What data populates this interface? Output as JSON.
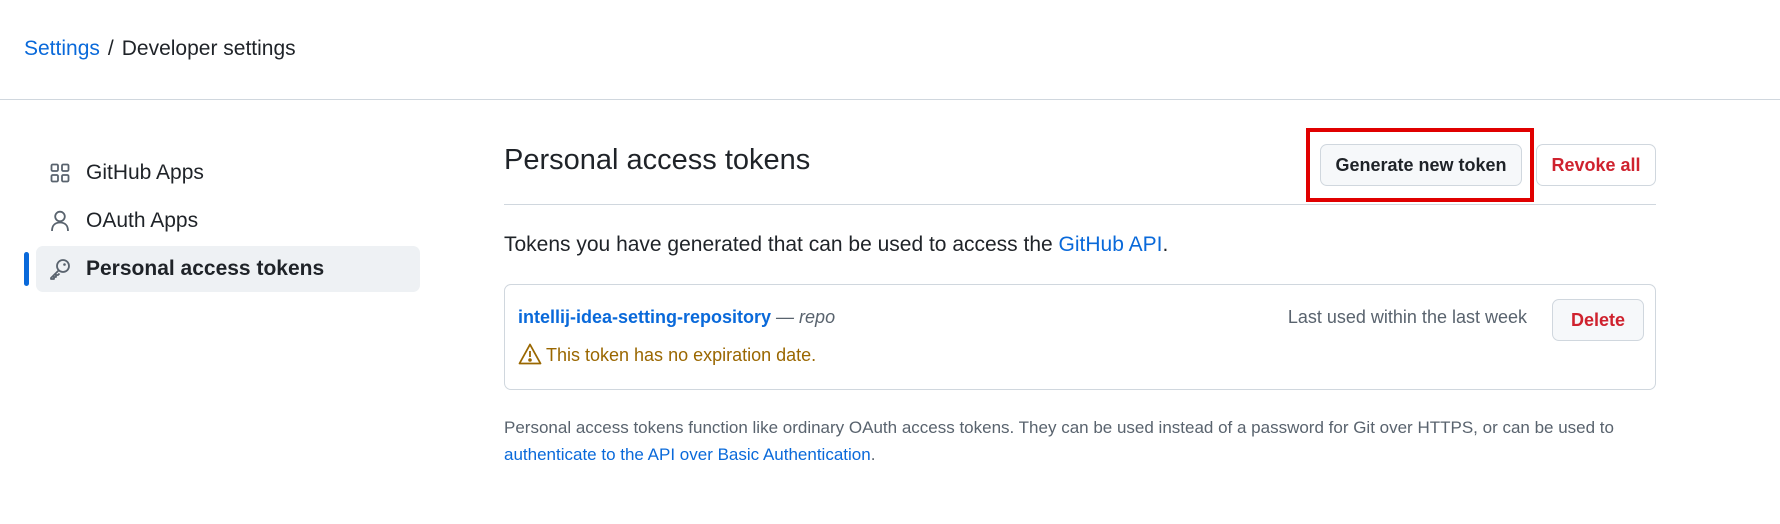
{
  "breadcrumb": {
    "parent": "Settings",
    "separator": "/",
    "current": "Developer settings"
  },
  "sidebar": {
    "items": [
      {
        "label": "GitHub Apps",
        "icon": "apps-grid-icon"
      },
      {
        "label": "OAuth Apps",
        "icon": "person-icon"
      },
      {
        "label": "Personal access tokens",
        "icon": "key-icon",
        "active": true
      }
    ]
  },
  "main": {
    "title": "Personal access tokens",
    "generate_label": "Generate new token",
    "revoke_label": "Revoke all",
    "intro_text": "Tokens you have generated that can be used to access the ",
    "intro_link": "GitHub API",
    "intro_end": ".",
    "tokens": [
      {
        "name": "intellij-idea-setting-repository",
        "scope_sep": " — ",
        "scope": "repo",
        "warning": "This token has no expiration date.",
        "last_used": "Last used within the last week",
        "delete_label": "Delete"
      }
    ],
    "footnote_text": "Personal access tokens function like ordinary OAuth access tokens. They can be used instead of a password for Git over HTTPS, or can be used to ",
    "footnote_link": "authenticate to the API over Basic Authentication",
    "footnote_end": "."
  },
  "colors": {
    "link": "#0969da",
    "danger": "#cf222e",
    "warning": "#9a6700",
    "highlight": "#e00000",
    "active_indicator": "#0969da"
  }
}
